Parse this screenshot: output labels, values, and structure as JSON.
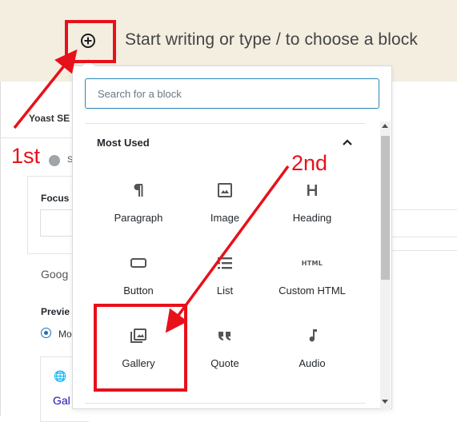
{
  "editor": {
    "placeholder": "Start writing or type / to choose a block"
  },
  "background": {
    "yoast_label": "Yoast SE",
    "s_letter": "S",
    "focus_label": "Focus k",
    "google_label": "Goog",
    "preview_label": "Previe",
    "radio_label": "Mo",
    "card_link": "Gal"
  },
  "inserter": {
    "search_placeholder": "Search for a block",
    "panel_title": "Most Used",
    "blocks": [
      {
        "label": "Paragraph",
        "icon": "paragraph-icon"
      },
      {
        "label": "Image",
        "icon": "image-icon"
      },
      {
        "label": "Heading",
        "icon": "heading-icon"
      },
      {
        "label": "Button",
        "icon": "button-icon"
      },
      {
        "label": "List",
        "icon": "list-icon"
      },
      {
        "label": "Custom HTML",
        "icon": "html-icon",
        "icon_text": "HTML"
      },
      {
        "label": "Gallery",
        "icon": "gallery-icon"
      },
      {
        "label": "Quote",
        "icon": "quote-icon"
      },
      {
        "label": "Audio",
        "icon": "audio-icon"
      }
    ]
  },
  "annotations": {
    "first": "1st",
    "second": "2nd",
    "color": "#e8101a"
  }
}
